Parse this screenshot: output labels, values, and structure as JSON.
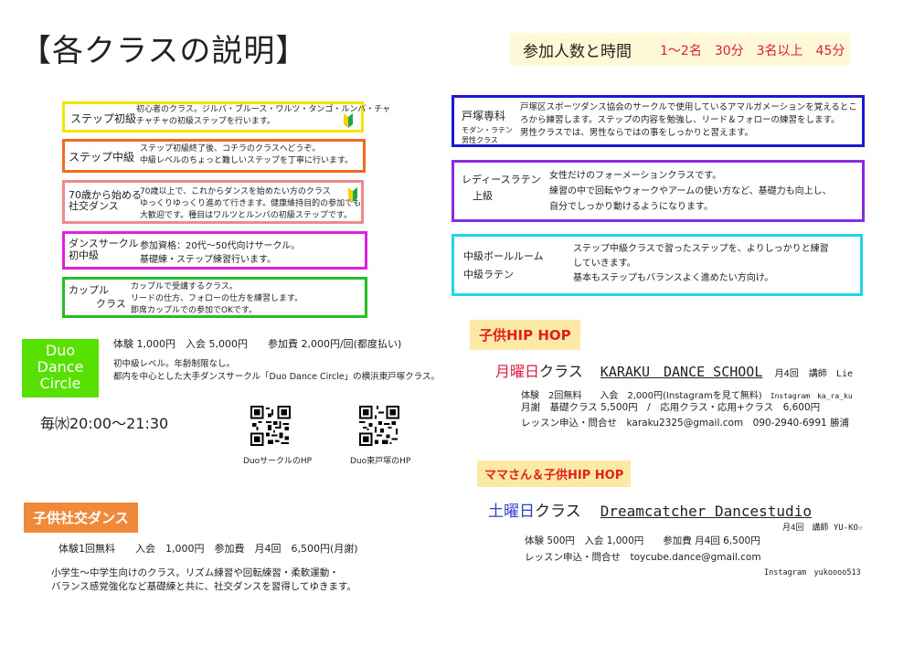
{
  "header": {
    "title": "【各クラスの説明】",
    "time_heading": "参加人数と時間",
    "time_detail": "1〜2名　30分　3名以上　45分"
  },
  "classes_left": [
    {
      "label": "ステップ初級",
      "lines": [
        "初心者のクラス。ジルバ・ブルース・ワルツ・タンゴ・ルンバ・チャ",
        "チャチャの初級ステップを行います。"
      ],
      "color": "#f2e600"
    },
    {
      "label": "ステップ中級",
      "lines": [
        "ステップ初級終了後、コチラのクラスへどうぞ。",
        "中級レベルのちょっと難しいステップを丁寧に行います。"
      ],
      "color": "#f26a1f"
    },
    {
      "label_lines": [
        "70歳から始める",
        "社交ダンス"
      ],
      "lines": [
        "70歳以上で、これからダンスを始めたい方のクラス",
        "ゆっくりゆっくり進めて行きます。健康維持目的の参加でも",
        "大歓迎です。種目はワルツとルンバの初級ステップです。"
      ],
      "color": "#f08a8a"
    },
    {
      "label_lines": [
        "ダンスサークル",
        "初中級"
      ],
      "lines": [
        "参加資格：20代〜50代向けサークル。",
        "基礎練・ステップ練習行います。"
      ],
      "color": "#e020e0"
    },
    {
      "label_lines": [
        "カップル",
        "クラス"
      ],
      "lines": [
        "カップルで受講するクラス。",
        "リードの仕方、フォローの仕方を練習します。",
        "即席カップルでの参加でOKです。"
      ],
      "color": "#22c022"
    }
  ],
  "classes_right": [
    {
      "label": "戸塚専科",
      "sub_lines": [
        "モダン・ラテン",
        "男性クラス"
      ],
      "lines": [
        "戸塚区スポーツダンス協会のサークルで使用しているアマルガメーションを覚えるとこ",
        "ろから練習します。ステップの内容を勉強し、リード＆フォローの練習をします。",
        "男性クラスでは、男性ならではの事をしっかりと習えます。"
      ],
      "color": "#1a1ad0"
    },
    {
      "label_lines": [
        "レディースラテン",
        "上級"
      ],
      "lines": [
        "女性だけのフォーメーションクラスです。",
        "練習の中で回転やウォークやアームの使い方など、基礎力も向上し、",
        "自分でしっかり動けるようになります。"
      ],
      "color": "#8a2be2"
    },
    {
      "label_lines": [
        "中級ボールルーム",
        "中級ラテン"
      ],
      "lines": [
        "ステップ中級クラスで習ったステップを、よりしっかりと練習",
        "していきます。",
        "基本もステップもバランスよく進めたい方向け。"
      ],
      "color": "#22d4e8"
    }
  ],
  "duo": {
    "logo_lines": [
      "Duo",
      "Dance",
      "Circle"
    ],
    "fees": "体験 1,000円　入会 5,000円　　参加費 2,000円/回(都度払い)",
    "desc_lines": [
      "初中級レベル。年齢制限なし。",
      "都内を中心とした大手ダンスサークル「Duo Dance Circle」の横浜東戸塚クラス。"
    ],
    "schedule": "毎㈬20:00〜21:30",
    "qr1_label": "DuoサークルのHP",
    "qr2_label": "Duo東戸塚のHP"
  },
  "kids_social": {
    "tag": "子供社交ダンス",
    "fees": "体験1回無料　　入会　1,000円　参加費　月4回　6,500円(月謝)",
    "desc_lines": [
      "小学生〜中学生向けのクラス。リズム練習や回転練習・柔軟運動・",
      "バランス感覚強化など基礎練と共に、社交ダンスを習得してゆきます。"
    ]
  },
  "kids_hiphop": {
    "tag": "子供HIP HOP",
    "day": "月曜日",
    "class_word": "クラス",
    "school": "KARAKU　DANCE SCHOOL",
    "freq": "月4回",
    "teacher": "講師　Lie",
    "trial": "体験　2回無料　　入会　2,000円(Instagramを見て無料)",
    "instagram": "Instagram　ka_ra_ku",
    "monthly": "月謝　基礎クラス 5,500円　/　応用クラス・応用+クラス　6,600円",
    "contact": "レッスン申込・問合せ　karaku2325@gmail.com　090-2940-6991 勝浦"
  },
  "mama_hiphop": {
    "tag": "ママさん＆子供HIP HOP",
    "day": "土曜日",
    "class_word": "クラス",
    "school": "Dreamcatcher Dancestudio",
    "freq_teacher": "月4回　講師 YU-KO☆",
    "fees": "体験 500円　入会 1,000円　　参加費 月4回 6,500円",
    "contact": "レッスン申込・問合せ　toycube.dance@gmail.com",
    "instagram": "Instagram　yukoooo513"
  },
  "icons": {
    "beginner": "beginner-mark-icon",
    "qr": "qr-code-icon"
  }
}
